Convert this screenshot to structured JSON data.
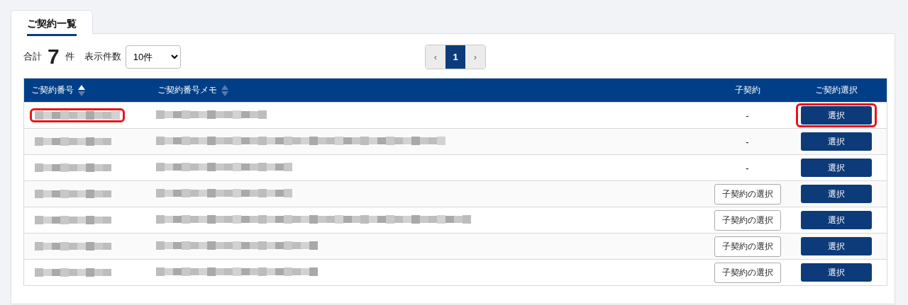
{
  "tabs": [
    {
      "label": "ご契約一覧",
      "selected": true
    }
  ],
  "summary": {
    "total_label": "合計",
    "total_count": "7",
    "total_unit": "件",
    "page_size_label": "表示件数",
    "page_size": "10件"
  },
  "pagination": {
    "prev": "‹",
    "pages": [
      {
        "label": "1",
        "selected": true
      }
    ],
    "next": "›"
  },
  "table": {
    "columns": [
      {
        "label": "ご契約番号",
        "sorted": true
      },
      {
        "label": "ご契約番号メモ",
        "sorted": false
      },
      {
        "label": "子契約"
      },
      {
        "label": "ご契約選択"
      }
    ],
    "rows": [
      {
        "sub_contract": {
          "kind": "dash",
          "text": "-"
        },
        "select": "選択",
        "highlighted": true
      },
      {
        "sub_contract": {
          "kind": "dash",
          "text": "-"
        },
        "select": "選択",
        "highlighted": false
      },
      {
        "sub_contract": {
          "kind": "dash",
          "text": "-"
        },
        "select": "選択",
        "highlighted": false
      },
      {
        "sub_contract": {
          "kind": "button",
          "text": "子契約の選択"
        },
        "select": "選択",
        "highlighted": false
      },
      {
        "sub_contract": {
          "kind": "button",
          "text": "子契約の選択"
        },
        "select": "選択",
        "highlighted": false
      },
      {
        "sub_contract": {
          "kind": "button",
          "text": "子契約の選択"
        },
        "select": "選択",
        "highlighted": false
      },
      {
        "sub_contract": {
          "kind": "button",
          "text": "子契約の選択"
        },
        "select": "選択",
        "highlighted": false
      }
    ]
  }
}
